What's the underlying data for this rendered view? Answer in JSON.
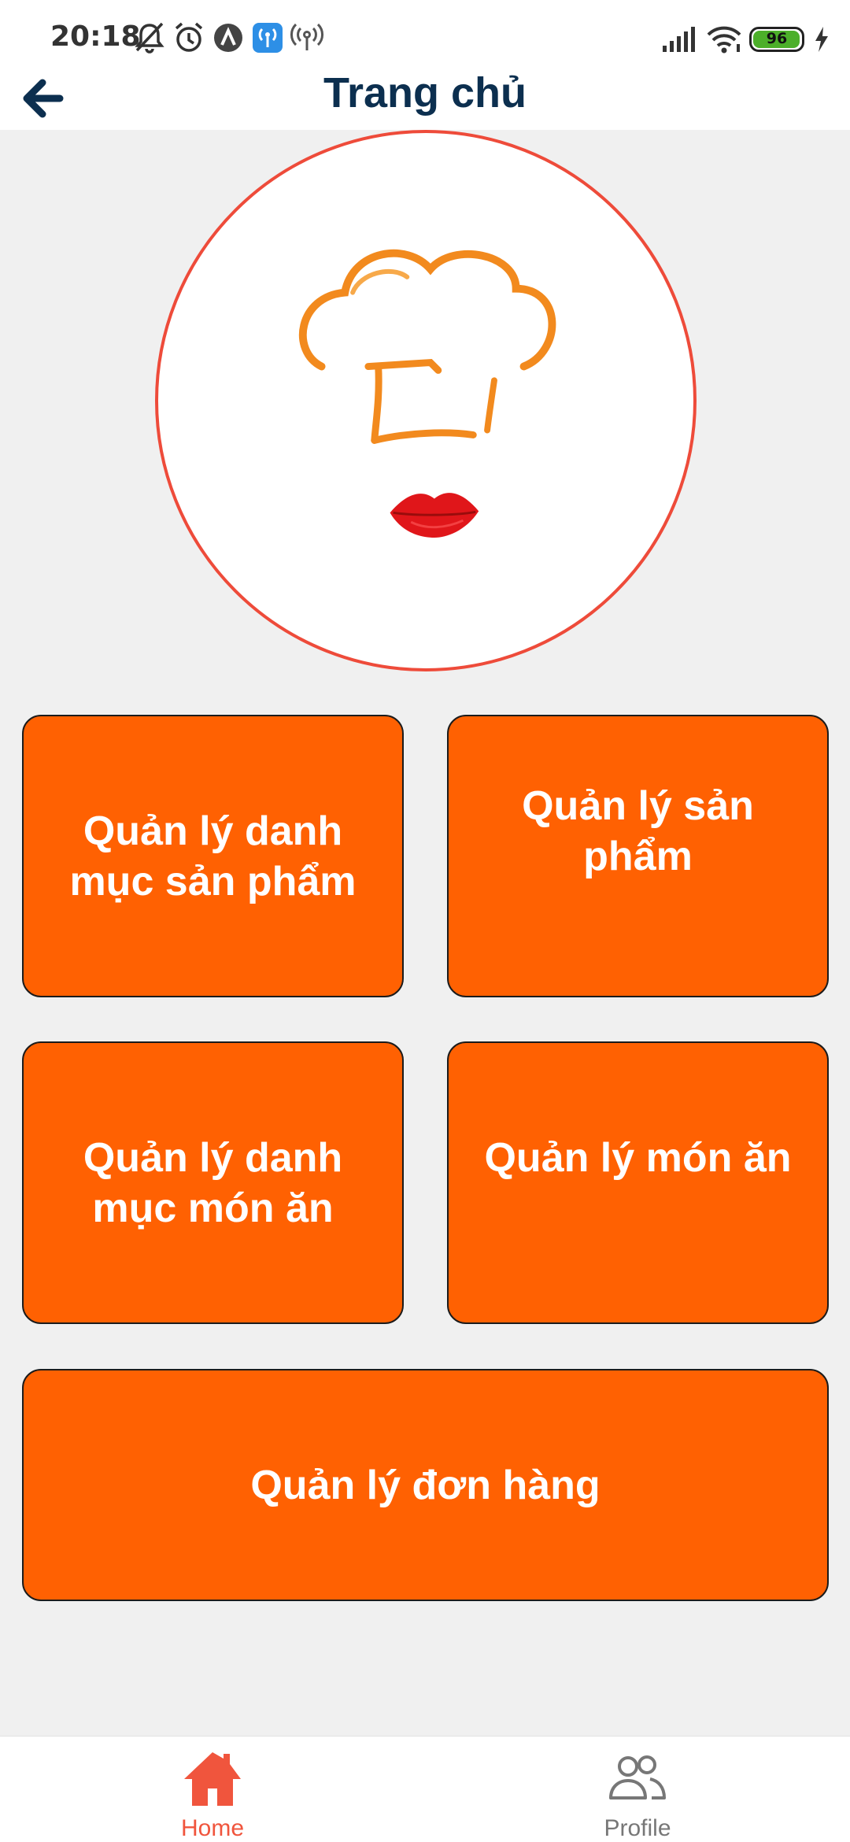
{
  "status_bar": {
    "time": "20:18",
    "battery_level": "96",
    "icons": [
      "mute-bell-icon",
      "alarm-icon",
      "nav-app-icon",
      "hotspot-app-icon",
      "hotspot-icon",
      "signal-icon",
      "wifi-icon",
      "battery-icon",
      "charging-icon"
    ]
  },
  "header": {
    "title": "Trang chủ",
    "back_icon": "arrow-left-icon"
  },
  "logo": {
    "description_icon": "chef-hat-lips-logo"
  },
  "menu": {
    "tiles": [
      {
        "label": "Quản lý danh mục sản phẩm"
      },
      {
        "label": "Quản lý sản phẩm"
      },
      {
        "label": "Quản lý danh mục món ăn"
      },
      {
        "label": "Quản lý món ăn"
      },
      {
        "label": "Quản lý đơn hàng"
      }
    ]
  },
  "bottom_nav": {
    "items": [
      {
        "label": "Home",
        "icon": "home-icon",
        "active": true
      },
      {
        "label": "Profile",
        "icon": "users-icon",
        "active": false
      }
    ]
  },
  "colors": {
    "tile_bg": "#ff6102",
    "title": "#0c2f4f",
    "active_nav": "#f0553d",
    "circle_border": "#ee4b3a"
  }
}
